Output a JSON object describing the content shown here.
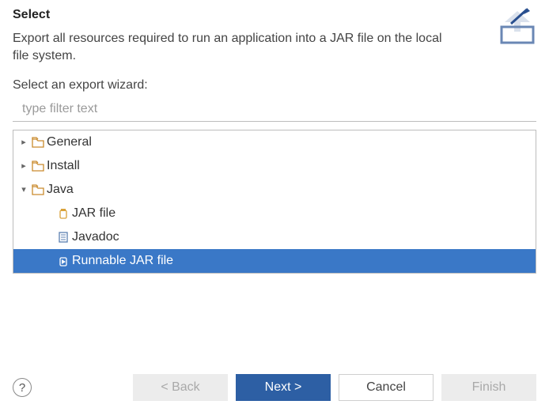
{
  "header": {
    "title": "Select",
    "subtitle": "Export all resources required to run an application into a JAR file on the local file system."
  },
  "label": "Select an export wizard:",
  "filter": {
    "placeholder": "type filter text",
    "value": ""
  },
  "tree": [
    {
      "id": "general",
      "label": "General",
      "depth": 1,
      "expandable": true,
      "expanded": false,
      "icon": "folder",
      "selected": false
    },
    {
      "id": "install",
      "label": "Install",
      "depth": 1,
      "expandable": true,
      "expanded": false,
      "icon": "folder",
      "selected": false
    },
    {
      "id": "java",
      "label": "Java",
      "depth": 1,
      "expandable": true,
      "expanded": true,
      "icon": "folder",
      "selected": false
    },
    {
      "id": "jar-file",
      "label": "JAR file",
      "depth": 2,
      "expandable": false,
      "icon": "jar",
      "selected": false
    },
    {
      "id": "javadoc",
      "label": "Javadoc",
      "depth": 2,
      "expandable": false,
      "icon": "javadoc",
      "selected": false
    },
    {
      "id": "runnable-jar",
      "label": "Runnable JAR file",
      "depth": 2,
      "expandable": false,
      "icon": "runjar",
      "selected": true
    }
  ],
  "buttons": {
    "back": "< Back",
    "next": "Next >",
    "cancel": "Cancel",
    "finish": "Finish"
  },
  "help_tooltip": "?"
}
